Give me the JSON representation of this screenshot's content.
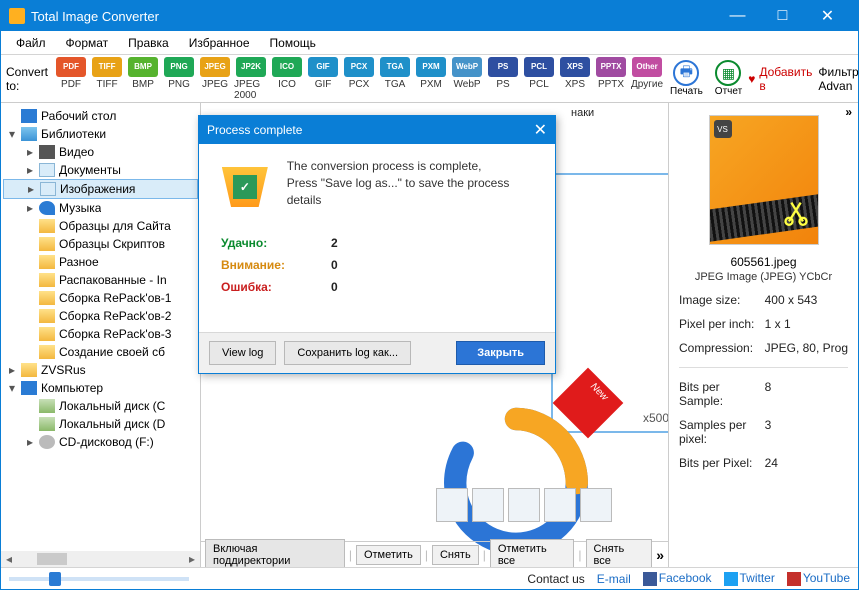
{
  "window": {
    "title": "Total Image Converter"
  },
  "menu": [
    "Файл",
    "Формат",
    "Правка",
    "Избранное",
    "Помощь"
  ],
  "toolbar": {
    "convert_label": "Convert to:",
    "formats": [
      {
        "code": "PDF",
        "label": "PDF",
        "color": "#e4562a"
      },
      {
        "code": "TIFF",
        "label": "TIFF",
        "color": "#e8a216"
      },
      {
        "code": "BMP",
        "label": "BMP",
        "color": "#56b32e"
      },
      {
        "code": "PNG",
        "label": "PNG",
        "color": "#1fa856"
      },
      {
        "code": "JPEG",
        "label": "JPEG",
        "color": "#e8a216"
      },
      {
        "code": "JP2K",
        "label": "JPEG 2000",
        "color": "#1fa856"
      },
      {
        "code": "ICO",
        "label": "ICO",
        "color": "#1fa856"
      },
      {
        "code": "GIF",
        "label": "GIF",
        "color": "#1f90c9"
      },
      {
        "code": "PCX",
        "label": "PCX",
        "color": "#1f90c9"
      },
      {
        "code": "TGA",
        "label": "TGA",
        "color": "#1f90c9"
      },
      {
        "code": "PXM",
        "label": "PXM",
        "color": "#1f90c9"
      },
      {
        "code": "WebP",
        "label": "WebP",
        "color": "#4593c9"
      },
      {
        "code": "PS",
        "label": "PS",
        "color": "#2e4fa1"
      },
      {
        "code": "PCL",
        "label": "PCL",
        "color": "#2e4fa1"
      },
      {
        "code": "XPS",
        "label": "XPS",
        "color": "#2e4fa1"
      },
      {
        "code": "PPTX",
        "label": "PPTX",
        "color": "#a04ba1"
      },
      {
        "code": "Other",
        "label": "Другие",
        "color": "#c14da1"
      }
    ],
    "print": "Печать",
    "report": "Отчет",
    "add_fav": "Добавить в",
    "filter_label": "Фильтр:",
    "filter_value": "Advan"
  },
  "tree": [
    {
      "indent": 0,
      "arrow": "",
      "icon": "desktop",
      "label": "Рабочий стол"
    },
    {
      "indent": 0,
      "arrow": "▾",
      "icon": "lib",
      "label": "Библиотеки"
    },
    {
      "indent": 1,
      "arrow": "▸",
      "icon": "vid",
      "label": "Видео"
    },
    {
      "indent": 1,
      "arrow": "▸",
      "icon": "doc",
      "label": "Документы"
    },
    {
      "indent": 1,
      "arrow": "▸",
      "icon": "img",
      "label": "Изображения",
      "sel": true
    },
    {
      "indent": 1,
      "arrow": "▸",
      "icon": "mus",
      "label": "Музыка"
    },
    {
      "indent": 1,
      "arrow": "",
      "icon": "folder",
      "label": "Образцы для Сайта"
    },
    {
      "indent": 1,
      "arrow": "",
      "icon": "folder",
      "label": "Образцы Скриптов"
    },
    {
      "indent": 1,
      "arrow": "",
      "icon": "folder",
      "label": "Разное"
    },
    {
      "indent": 1,
      "arrow": "",
      "icon": "folder",
      "label": "Распакованные - In"
    },
    {
      "indent": 1,
      "arrow": "",
      "icon": "folder",
      "label": "Сборка RePack'ов-1"
    },
    {
      "indent": 1,
      "arrow": "",
      "icon": "folder",
      "label": "Сборка RePack'ов-2"
    },
    {
      "indent": 1,
      "arrow": "",
      "icon": "folder",
      "label": "Сборка RePack'ов-3"
    },
    {
      "indent": 1,
      "arrow": "",
      "icon": "folder",
      "label": "Создание своей сб"
    },
    {
      "indent": 0,
      "arrow": "▸",
      "icon": "folder",
      "label": "ZVSRus"
    },
    {
      "indent": 0,
      "arrow": "▾",
      "icon": "desktop",
      "label": "Компьютер"
    },
    {
      "indent": 1,
      "arrow": "",
      "icon": "drive",
      "label": "Локальный диск (C"
    },
    {
      "indent": 1,
      "arrow": "",
      "icon": "drive",
      "label": "Локальный диск (D"
    },
    {
      "indent": 1,
      "arrow": "▸",
      "icon": "cd",
      "label": "CD-дисковод (F:)"
    }
  ],
  "center": {
    "top_hint": "наки",
    "thumb_dim": "x500",
    "bottom_buttons": [
      "Включая поддиректории",
      "Отметить",
      "Снять",
      "Отметить все",
      "Снять все"
    ],
    "more": "»"
  },
  "right": {
    "more": "»",
    "filename": "605561.jpeg",
    "filetype": "JPEG Image (JPEG) YCbCr",
    "props": [
      {
        "k": "Image size:",
        "v": "400 x 543"
      },
      {
        "k": "Pixel per inch:",
        "v": "1 x 1"
      },
      {
        "k": "Compression:",
        "v": "JPEG, 80, Prog"
      }
    ],
    "props2": [
      {
        "k": "Bits per Sample:",
        "v": "8"
      },
      {
        "k": "Samples per pixel:",
        "v": "3"
      },
      {
        "k": "Bits per Pixel:",
        "v": "24"
      }
    ]
  },
  "footer": {
    "contact": "Contact us",
    "email": "E-mail",
    "fb": "Facebook",
    "tw": "Twitter",
    "yt": "YouTube"
  },
  "dialog": {
    "title": "Process complete",
    "msg1": "The conversion process is complete,",
    "msg2": "Press \"Save log as...\" to save the process details",
    "ok_label": "Удачно:",
    "ok_val": "2",
    "warn_label": "Внимание:",
    "warn_val": "0",
    "err_label": "Ошибка:",
    "err_val": "0",
    "view_log": "View log",
    "save_log": "Сохранить log как...",
    "close": "Закрыть"
  }
}
